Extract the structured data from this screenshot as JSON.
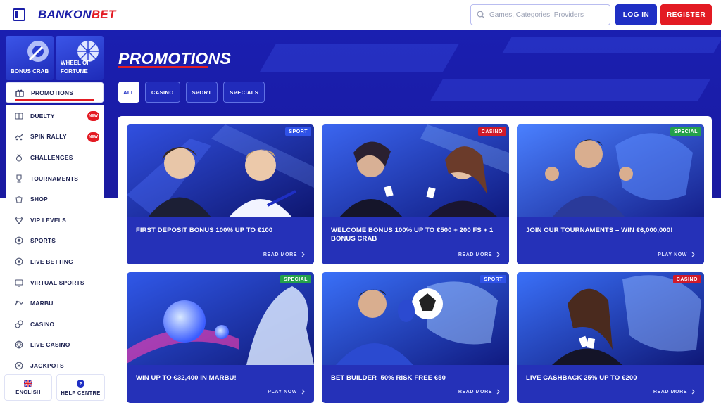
{
  "header": {
    "logo_main": "BANKON",
    "logo_accent": "BET",
    "search_placeholder": "Games, Categories, Providers",
    "login_label": "LOG IN",
    "register_label": "REGISTER"
  },
  "sidebar": {
    "tiles": [
      {
        "label": "BONUS CRAB"
      },
      {
        "label": "WHEEL OF FORTUNE"
      }
    ],
    "items": [
      {
        "label": "PROMOTIONS",
        "icon": "gift-icon",
        "active": true
      },
      {
        "label": "DUELTY",
        "icon": "duel-icon",
        "badge": "NEW"
      },
      {
        "label": "SPIN RALLY",
        "icon": "rally-icon",
        "badge": "NEW"
      },
      {
        "label": "CHALLENGES",
        "icon": "medal-icon"
      },
      {
        "label": "TOURNAMENTS",
        "icon": "trophy-icon"
      },
      {
        "label": "SHOP",
        "icon": "shop-icon"
      },
      {
        "label": "VIP LEVELS",
        "icon": "diamond-icon"
      },
      {
        "label": "SPORTS",
        "icon": "football-icon"
      },
      {
        "label": "LIVE BETTING",
        "icon": "live-betting-icon"
      },
      {
        "label": "VIRTUAL SPORTS",
        "icon": "monitor-icon"
      },
      {
        "label": "MARBU",
        "icon": "marbu-icon"
      },
      {
        "label": "CASINO",
        "icon": "casino-icon"
      },
      {
        "label": "LIVE CASINO",
        "icon": "chip-icon"
      },
      {
        "label": "JACKPOTS",
        "icon": "jackpot-icon"
      }
    ],
    "footer": {
      "language_label": "ENGLISH",
      "help_label": "HELP CENTRE"
    }
  },
  "page": {
    "title": "PROMOTIONS",
    "filters": [
      "ALL",
      "CASINO",
      "SPORT",
      "SPECIALS"
    ],
    "active_filter": "ALL"
  },
  "promotions": [
    {
      "badge": "SPORT",
      "title": "FIRST DEPOSIT BONUS 100% UP TO €100",
      "link": "READ MORE"
    },
    {
      "badge": "CASINO",
      "title": "WELCOME BONUS 100% UP TO €500 + 200 FS + 1 BONUS CRAB",
      "link": "READ MORE"
    },
    {
      "badge": "SPECIAL",
      "title": "JOIN OUR TOURNAMENTS – WIN €6,000,000!",
      "link": "PLAY NOW"
    },
    {
      "badge": "SPECIAL",
      "title": "WIN UP TO €32,400 IN MARBU!",
      "link": "PLAY NOW"
    },
    {
      "badge": "SPORT",
      "title": "BET BUILDER  50% RISK FREE €50",
      "link": "READ MORE"
    },
    {
      "badge": "CASINO",
      "title": "LIVE CASHBACK 25% UP TO €200",
      "link": "READ MORE"
    }
  ],
  "colors": {
    "brand_blue": "#1f2fc4",
    "brand_red": "#e31b23",
    "sport_badge": "#2f52e8",
    "casino_badge": "#d01a2a",
    "special_badge": "#24a14b"
  }
}
